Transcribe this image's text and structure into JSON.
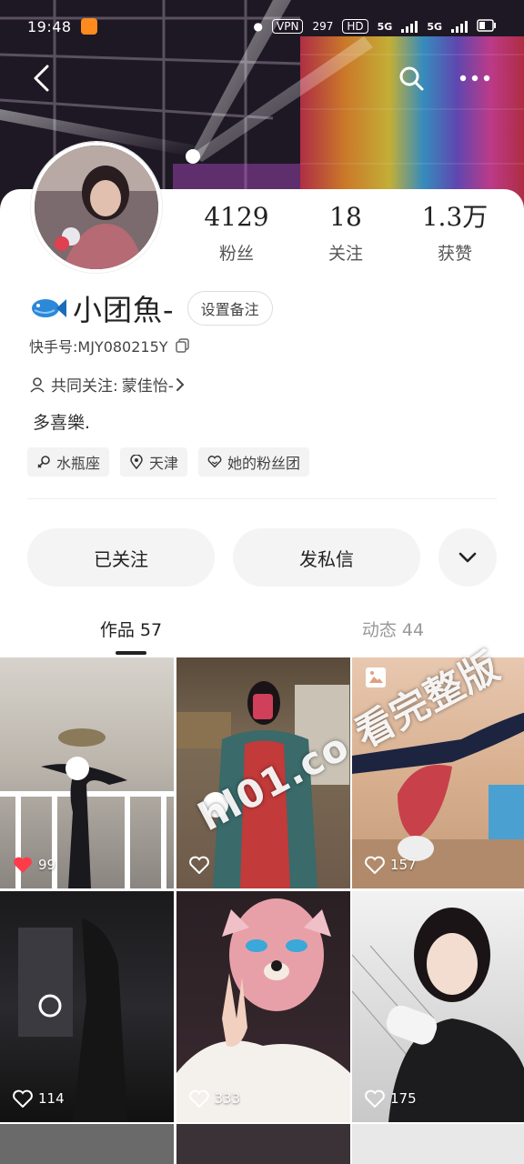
{
  "status_bar": {
    "time": "19:48",
    "vpn": "VPN",
    "speed": "297",
    "hd": "HD",
    "net1": "5G",
    "net2": "5G"
  },
  "profile": {
    "stats": [
      {
        "num": "4129",
        "label": "粉丝"
      },
      {
        "num": "18",
        "label": "关注"
      },
      {
        "num": "1.3万",
        "label": "获赞"
      }
    ],
    "name": "小团魚-",
    "remark_button": "设置备注",
    "kuaishou_id": "快手号:MJY080215Y",
    "mutual_label": "共同关注:",
    "mutual_name": "蒙佳怡-",
    "bio": "多喜樂.",
    "tags": [
      {
        "icon": "female-icon",
        "text": "水瓶座"
      },
      {
        "icon": "location-icon",
        "text": "天津"
      },
      {
        "icon": "fan-club-icon",
        "text": "她的粉丝团"
      }
    ]
  },
  "actions": {
    "followed": "已关注",
    "message": "发私信"
  },
  "tabs": [
    {
      "label": "作品 57",
      "active": true
    },
    {
      "label": "动态 44",
      "active": false
    }
  ],
  "works": [
    {
      "likes": "99",
      "liked": true
    },
    {
      "likes": "",
      "liked": false
    },
    {
      "likes": "157",
      "liked": false
    },
    {
      "likes": "114",
      "liked": false
    },
    {
      "likes": "333",
      "liked": false
    },
    {
      "likes": "175",
      "liked": false
    }
  ],
  "watermark": "hl01.co 看完整版",
  "colors": {
    "like_red": "#ff3b4a",
    "button_bg": "#f4f4f4",
    "accent": "#222222"
  }
}
